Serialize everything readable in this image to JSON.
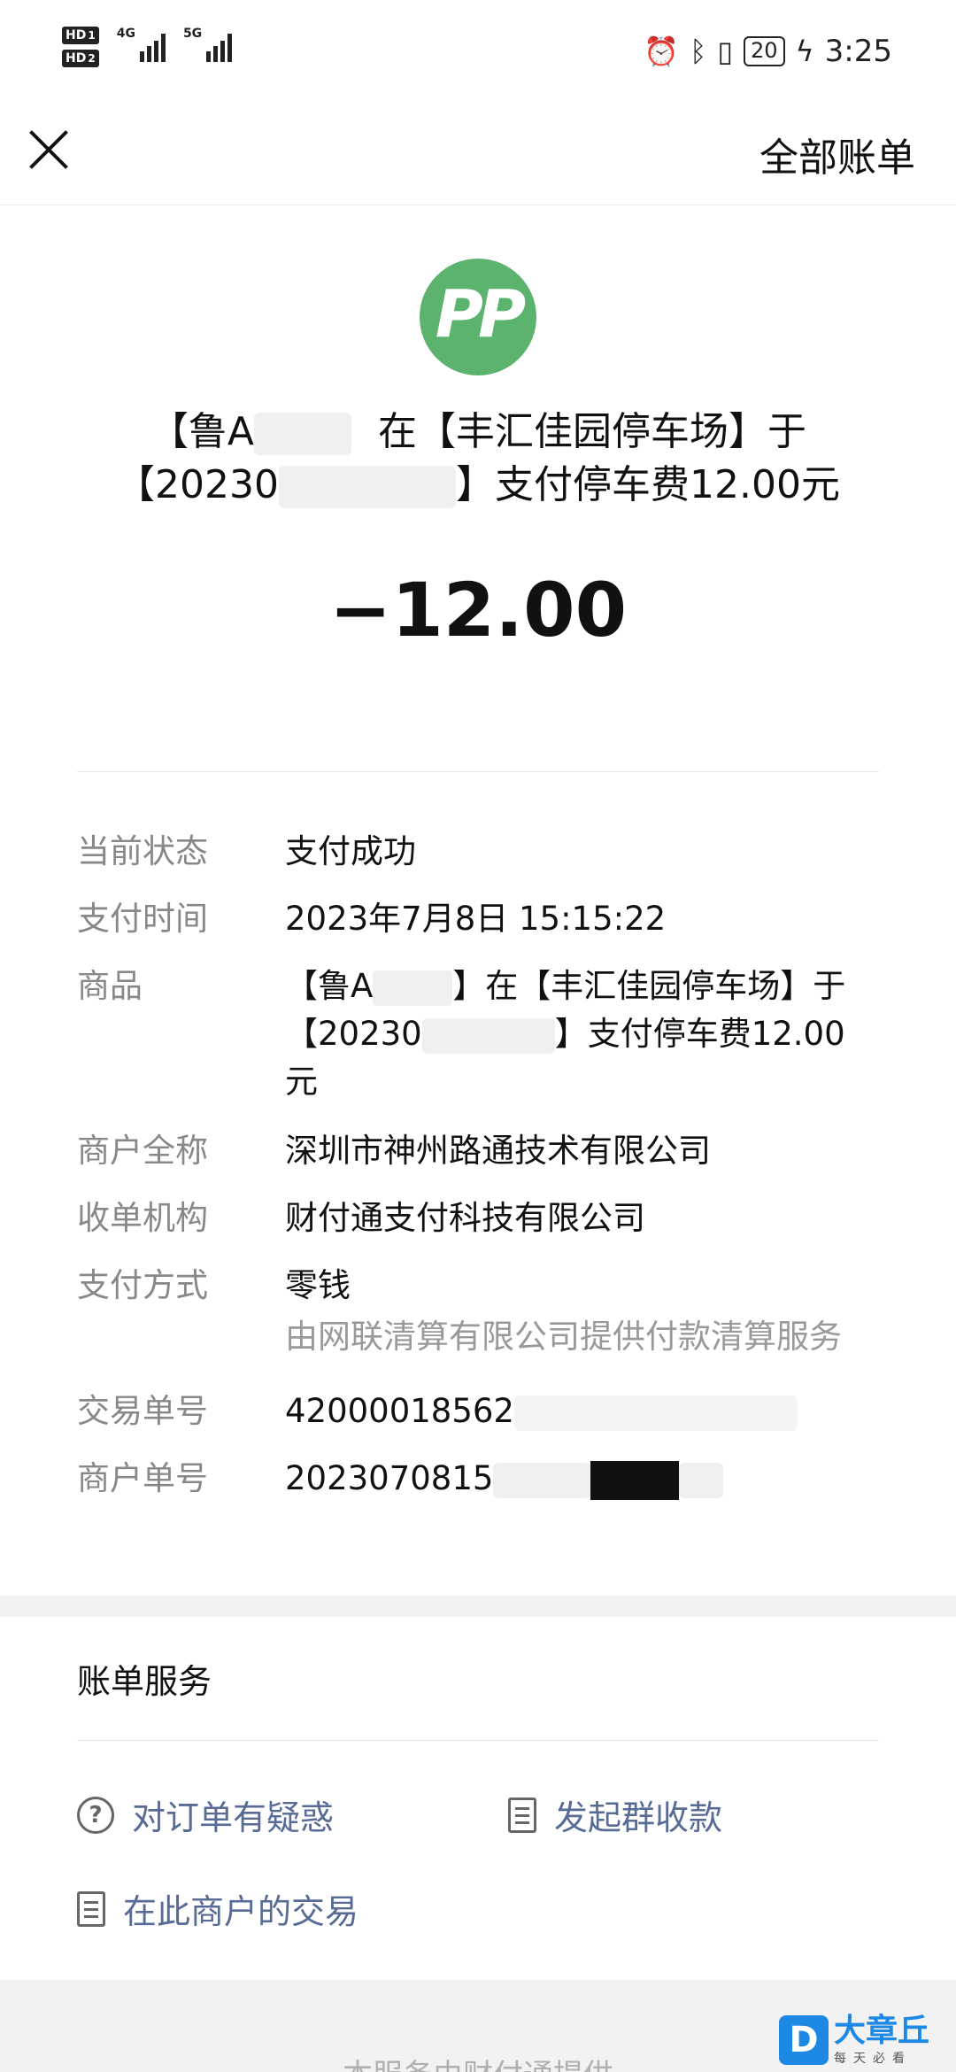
{
  "status_bar": {
    "hd1": "HD",
    "hd1_sub": "1",
    "hd2": "HD",
    "hd2_sub": "2",
    "net1": "4G",
    "net2": "5G",
    "battery": "20",
    "time": "3:25"
  },
  "header": {
    "right_label": "全部账单"
  },
  "merchant": {
    "logo_text": "PP",
    "desc_line1_a": "【鲁A",
    "desc_line1_b": "在【丰汇佳园停车场】于",
    "desc_line2_a": "【20230",
    "desc_line2_b": "】支付停车费12.00元"
  },
  "amount": "−12.00",
  "details": [
    {
      "key": "当前状态",
      "value": "支付成功"
    },
    {
      "key": "支付时间",
      "value": "2023年7月8日 15:15:22"
    },
    {
      "key": "商品",
      "value_a": "【鲁A",
      "value_b": "】在【丰汇佳园停车场】于",
      "value_c": "【20230",
      "value_d": "】支付停车费12.00",
      "value_e": "元"
    },
    {
      "key": "商户全称",
      "value": "深圳市神州路通技术有限公司"
    },
    {
      "key": "收单机构",
      "value": "财付通支付科技有限公司"
    },
    {
      "key": "支付方式",
      "value": "零钱",
      "sub": "由网联清算有限公司提供付款清算服务"
    },
    {
      "key": "交易单号",
      "value": "42000018562"
    },
    {
      "key": "商户单号",
      "value": "2023070815"
    }
  ],
  "service": {
    "title": "账单服务",
    "items": [
      {
        "label": "对订单有疑惑",
        "icon": "question-icon"
      },
      {
        "label": "发起群收款",
        "icon": "document-icon"
      },
      {
        "label": "在此商户的交易",
        "icon": "document-icon"
      }
    ]
  },
  "footer": {
    "text": "本服务由财付通提供"
  },
  "watermark": {
    "logo": "D",
    "title": "大章丘",
    "sub": "每天必看"
  }
}
